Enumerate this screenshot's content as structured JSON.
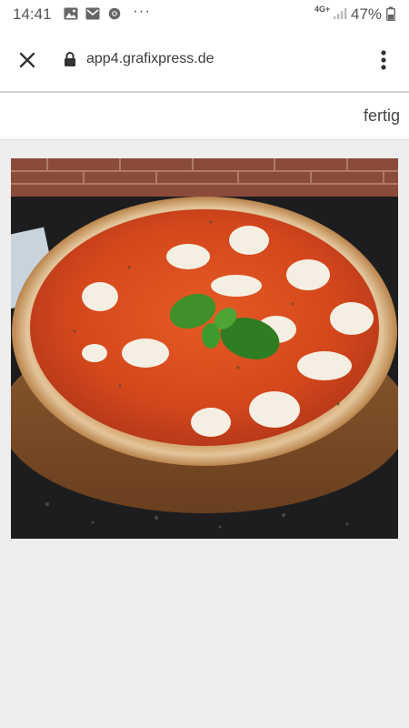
{
  "status_bar": {
    "time": "14:41",
    "icons": [
      "gallery-icon",
      "gmail-icon",
      "chrome-icon"
    ],
    "more": "···",
    "network": "4G+",
    "battery_percent": "47%"
  },
  "browser": {
    "url": "app4.grafixpress.de",
    "close_icon": "close-icon",
    "lock_icon": "lock-icon",
    "menu_icon": "more-vert-icon"
  },
  "page": {
    "done_label": "fertig"
  },
  "image": {
    "subject": "pizza-margherita"
  },
  "colors": {
    "background": "#eeeeee",
    "bar": "#ffffff",
    "text": "#444444"
  }
}
